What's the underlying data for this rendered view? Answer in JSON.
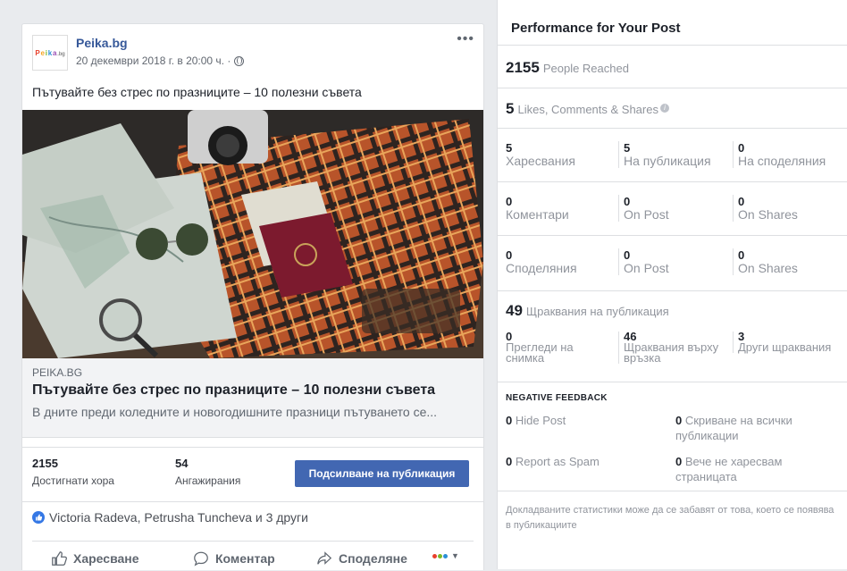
{
  "post": {
    "page_name": "Peika.bg",
    "logo_text": "Peika.bg",
    "timestamp": "20 декември 2018 г. в 20:00 ч. ·",
    "text": "Пътувайте без стрес по празниците – 10 полезни съвета",
    "link": {
      "domain": "PEIKA.BG",
      "title": "Пътувайте без стрес по празниците – 10 полезни съвета",
      "description": "В дните преди коледните и новогодишните празници пътуването се..."
    },
    "stats": {
      "reach_value": "2155",
      "reach_label": "Достигнати хора",
      "engagement_value": "54",
      "engagement_label": "Ангажирания"
    },
    "boost_label": "Подсилване на публикация",
    "reactions_text": "Victoria Radeva, Petrusha Tuncheva и 3 други",
    "actions": {
      "like": "Харесване",
      "comment": "Коментар",
      "share": "Споделяне"
    }
  },
  "panel": {
    "title": "Performance for Your Post",
    "reached_value": "2155",
    "reached_label": "People Reached",
    "engagement_value": "5",
    "engagement_label": "Likes, Comments & Shares",
    "likes": {
      "total": "5",
      "total_label": "Харесвания",
      "on_post": "5",
      "on_post_label": "На публикация",
      "on_shares": "0",
      "on_shares_label": "На споделяния"
    },
    "comments": {
      "total": "0",
      "total_label": "Коментари",
      "on_post": "0",
      "on_post_label": "On Post",
      "on_shares": "0",
      "on_shares_label": "On Shares"
    },
    "shares": {
      "total": "0",
      "total_label": "Споделяния",
      "on_post": "0",
      "on_post_label": "On Post",
      "on_shares": "0",
      "on_shares_label": "On Shares"
    },
    "clicks_value": "49",
    "clicks_label": "Щраквания на публикация",
    "clicks": {
      "photo": "0",
      "photo_label": "Прегледи на снимка",
      "link": "46",
      "link_label": "Щраквания върху връзка",
      "other": "3",
      "other_label": "Други щраквания"
    },
    "negative": {
      "heading": "NEGATIVE FEEDBACK",
      "hide_post": "0",
      "hide_post_label": "Hide Post",
      "hide_all": "0",
      "hide_all_label": "Скриване на всички публикации",
      "spam": "0",
      "spam_label": "Report as Spam",
      "unlike": "0",
      "unlike_label": "Вече не харесвам страницата"
    },
    "footnote": "Докладваните статистики може да се забавят от това, което се появява в публикациите"
  }
}
